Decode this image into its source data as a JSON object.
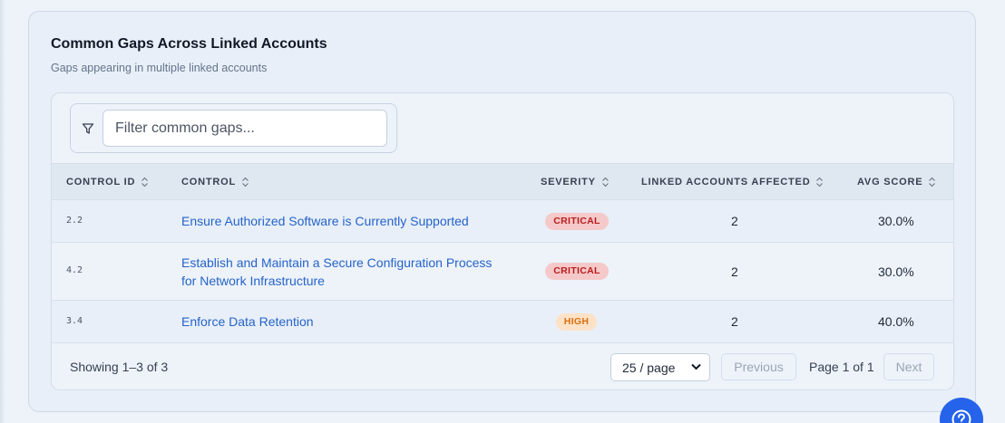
{
  "card": {
    "title": "Common Gaps Across Linked Accounts",
    "subtitle": "Gaps appearing in multiple linked accounts"
  },
  "filter": {
    "placeholder": "Filter common gaps...",
    "value": ""
  },
  "table": {
    "headers": {
      "control_id": "CONTROL ID",
      "control": "CONTROL",
      "severity": "SEVERITY",
      "linked_accounts_affected": "LINKED ACCOUNTS AFFECTED",
      "avg_score": "AVG SCORE"
    },
    "rows": [
      {
        "control_id": "2.2",
        "control_line1": "Ensure Authorized Software is Currently Supported",
        "control_line2": "",
        "severity": "CRITICAL",
        "affected": "2",
        "avg_score": "30.0%"
      },
      {
        "control_id": "4.2",
        "control_line1": "Establish and Maintain a Secure Configuration Process",
        "control_line2": "for Network Infrastructure",
        "severity": "CRITICAL",
        "affected": "2",
        "avg_score": "30.0%"
      },
      {
        "control_id": "3.4",
        "control_line1": "Enforce Data Retention",
        "control_line2": "",
        "severity": "HIGH",
        "affected": "2",
        "avg_score": "40.0%"
      }
    ]
  },
  "pagination": {
    "showing": "Showing 1–3 of 3",
    "page_size": "25 / page",
    "previous": "Previous",
    "page_info": "Page 1 of 1",
    "next": "Next"
  },
  "colors": {
    "link": "#2563c9",
    "critical_bg": "#f5c9c9",
    "critical_text": "#b91c1c",
    "high_bg": "#fde2c7",
    "high_text": "#d9700f",
    "help_button": "#2563eb"
  },
  "icons": {
    "filter": "filter-icon",
    "sort": "sort-icon",
    "select_caret": "chevron-down-icon",
    "help": "help-icon"
  }
}
